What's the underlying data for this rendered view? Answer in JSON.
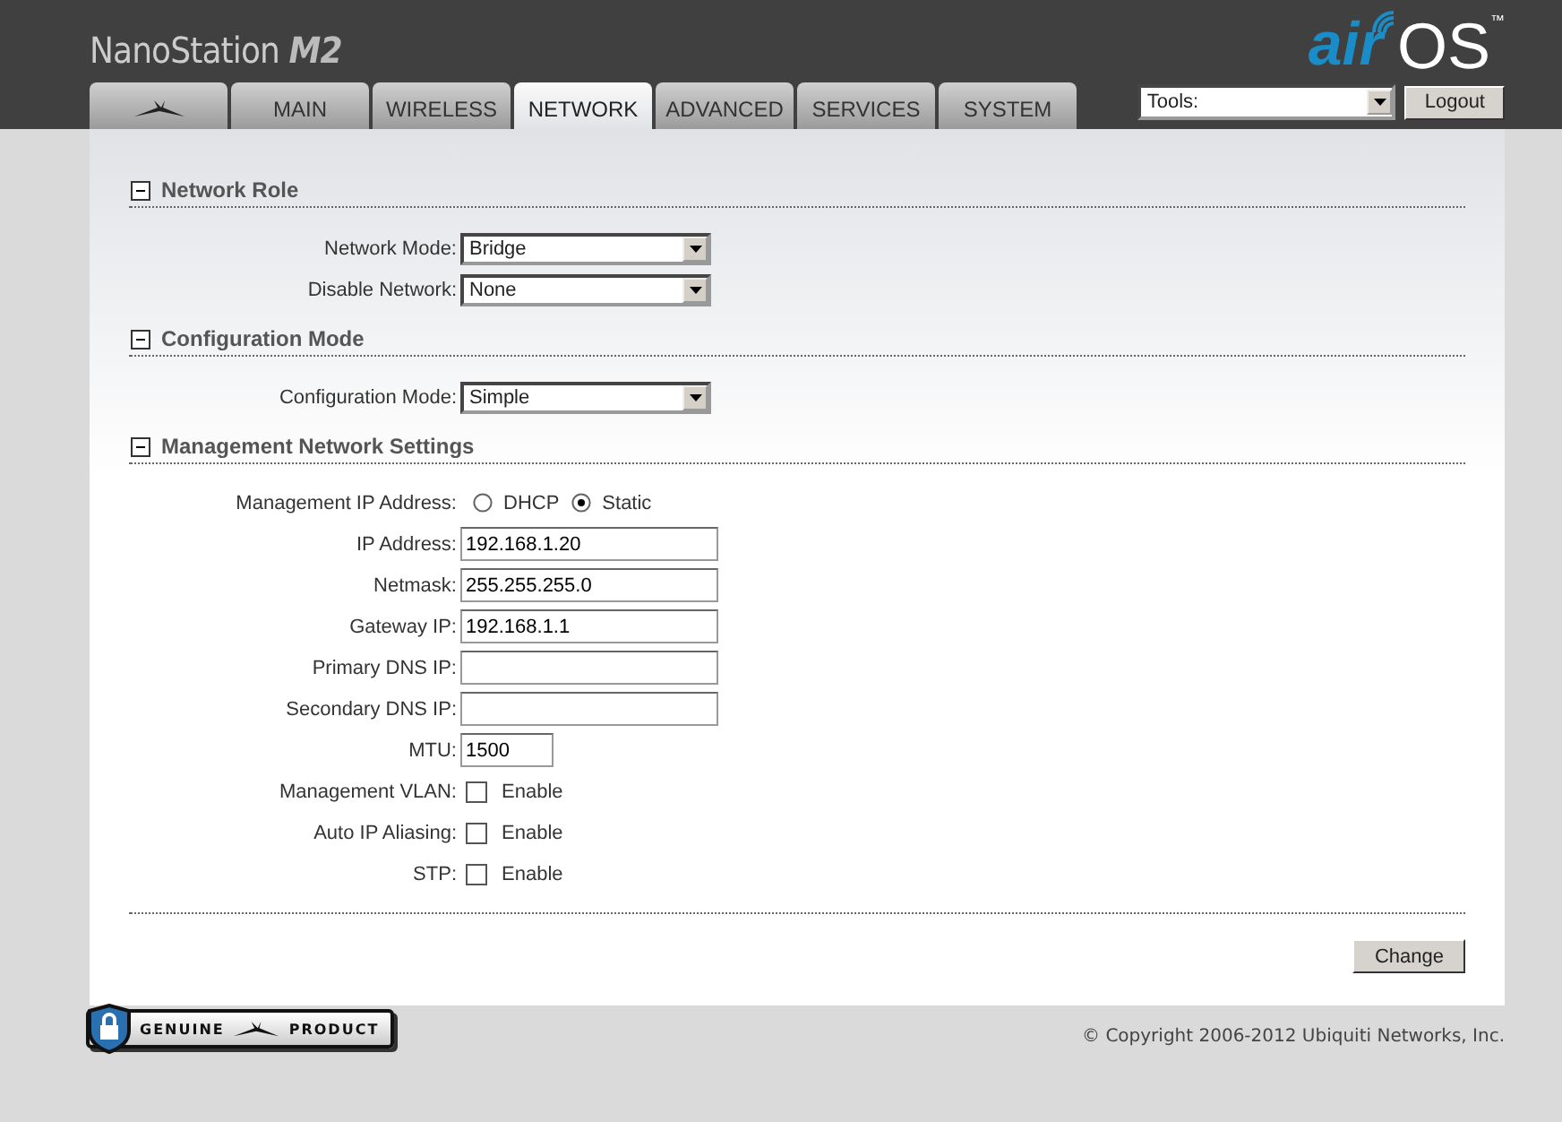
{
  "header": {
    "product": "NanoStation",
    "model": "M2",
    "brand_air": "air",
    "brand_os": "OS",
    "trademark": "™"
  },
  "tabs": [
    {
      "kind": "logo",
      "selected": false
    },
    {
      "kind": "text",
      "label": "MAIN",
      "selected": false
    },
    {
      "kind": "text",
      "label": "WIRELESS",
      "selected": false
    },
    {
      "kind": "text",
      "label": "NETWORK",
      "selected": true
    },
    {
      "kind": "text",
      "label": "ADVANCED",
      "selected": false
    },
    {
      "kind": "text",
      "label": "SERVICES",
      "selected": false
    },
    {
      "kind": "text",
      "label": "SYSTEM",
      "selected": false
    }
  ],
  "tools": {
    "value": "Tools:"
  },
  "logout_button": "Logout",
  "sections": [
    {
      "title": "Network Role",
      "expanded": true,
      "fields": [
        {
          "kind": "select",
          "label": "Network Mode:",
          "value": "Bridge"
        },
        {
          "kind": "select",
          "label": "Disable Network:",
          "value": "None"
        }
      ]
    },
    {
      "title": "Configuration Mode",
      "expanded": true,
      "fields": [
        {
          "kind": "select",
          "label": "Configuration Mode:",
          "value": "Simple"
        }
      ]
    },
    {
      "title": "Management Network Settings",
      "expanded": true,
      "fields": [
        {
          "kind": "radio",
          "label": "Management IP Address:",
          "options": [
            {
              "label": "DHCP",
              "selected": false
            },
            {
              "label": "Static",
              "selected": true
            }
          ]
        },
        {
          "kind": "text",
          "label": "IP Address:",
          "value": "192.168.1.20"
        },
        {
          "kind": "text",
          "label": "Netmask:",
          "value": "255.255.255.0"
        },
        {
          "kind": "text",
          "label": "Gateway IP:",
          "value": "192.168.1.1"
        },
        {
          "kind": "text",
          "label": "Primary DNS IP:"
        },
        {
          "kind": "text",
          "label": "Secondary DNS IP:"
        },
        {
          "kind": "short",
          "label": "MTU:",
          "value": "1500"
        },
        {
          "kind": "checkbox",
          "label": "Management VLAN:",
          "option": "Enable",
          "checked": false
        },
        {
          "kind": "checkbox",
          "label": "Auto IP Aliasing:",
          "option": "Enable",
          "checked": false
        },
        {
          "kind": "checkbox",
          "label": "STP:",
          "option": "Enable",
          "checked": false
        }
      ]
    }
  ],
  "change_button": "Change",
  "badge": {
    "left": "GENUINE",
    "right": "PRODUCT"
  },
  "copyright": "© Copyright 2006-2012 Ubiquiti Networks, Inc."
}
